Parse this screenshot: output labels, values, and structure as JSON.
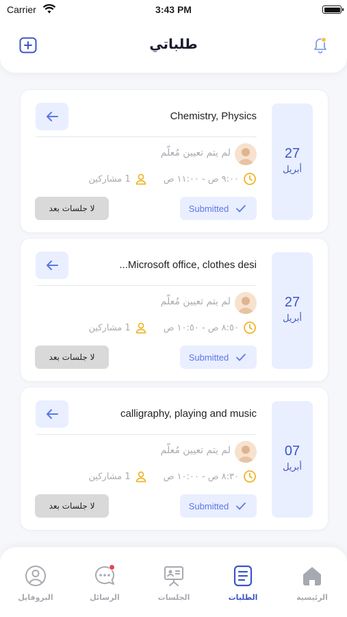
{
  "status_bar": {
    "carrier": "Carrier",
    "time": "3:43 PM"
  },
  "header": {
    "title": "طلباتي",
    "add_icon": "plus-square-icon",
    "bell_icon": "bell-icon"
  },
  "colors": {
    "accent": "#3a55c9",
    "accent_light": "#e9efff",
    "muted": "#a9abb2",
    "gray_button": "#d9d9d9",
    "badge": "#e54848"
  },
  "requests": [
    {
      "day": "27",
      "month": "أبريل",
      "subjects": "Chemistry, Physics",
      "teacher": "لم يتم تعيين مُعلّم",
      "time": "٩:٠٠ ص - ١١:٠٠ ص",
      "participants": "1 مشاركين",
      "status": "Submitted",
      "sessions_label": "لا جلسات بعد"
    },
    {
      "day": "27",
      "month": "أبريل",
      "subjects": "...Microsoft office, clothes desi",
      "teacher": "لم يتم تعيين مُعلّم",
      "time": "٨:٥٠ ص - ١٠:٥٠ ص",
      "participants": "1 مشاركين",
      "status": "Submitted",
      "sessions_label": "لا جلسات بعد"
    },
    {
      "day": "07",
      "month": "أبريل",
      "subjects": "calligraphy, playing and music",
      "teacher": "لم يتم تعيين مُعلّم",
      "time": "٨:٣٠ ص - ١٠:٠٠ ص",
      "participants": "1 مشاركين",
      "status": "Submitted",
      "sessions_label": "لا جلسات بعد"
    }
  ],
  "tabs": [
    {
      "label": "البروفايل",
      "icon": "profile-icon",
      "active": false
    },
    {
      "label": "الرسائل",
      "icon": "chat-icon",
      "active": false
    },
    {
      "label": "الجلسات",
      "icon": "presentation-icon",
      "active": false
    },
    {
      "label": "الطلبات",
      "icon": "document-icon",
      "active": true
    },
    {
      "label": "الرئيسية",
      "icon": "home-icon",
      "active": false
    }
  ]
}
